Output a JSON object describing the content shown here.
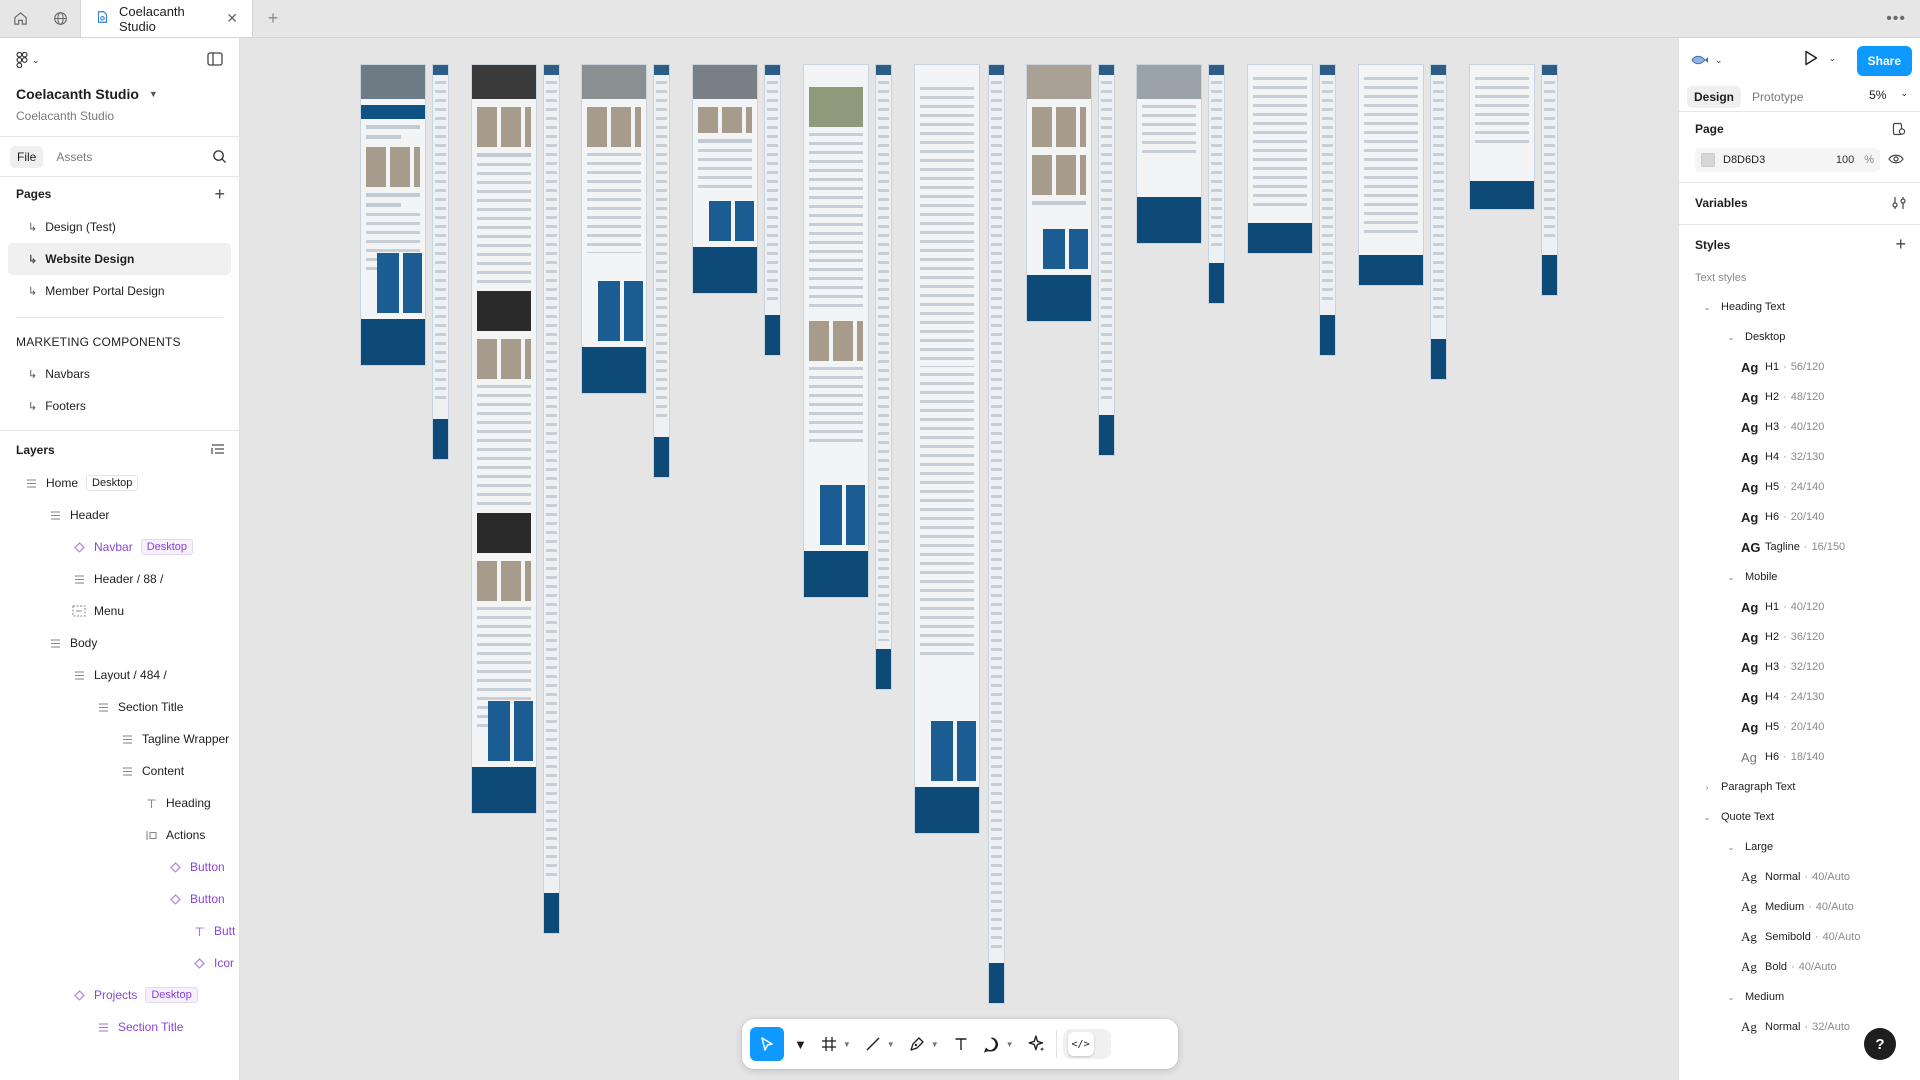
{
  "tabbar": {
    "tab_title": "Coelacanth Studio"
  },
  "left": {
    "project_name": "Coelacanth Studio",
    "team_name": "Coelacanth Studio",
    "tabs": {
      "file": "File",
      "assets": "Assets"
    },
    "pages_label": "Pages",
    "pages": [
      {
        "label": "Design (Test)"
      },
      {
        "label": "Website Design",
        "selected": true
      },
      {
        "label": "Member Portal Design"
      }
    ],
    "group_label": "MARKETING COMPONENTS",
    "group_pages": [
      {
        "label": "Navbars"
      },
      {
        "label": "Footers"
      }
    ],
    "layers_label": "Layers",
    "layers": [
      {
        "label": "Home",
        "badge": "Desktop",
        "icon": "frame-icon",
        "component": false
      },
      {
        "label": "Header",
        "badge": "",
        "icon": "frame-icon",
        "component": false
      },
      {
        "label": "Navbar",
        "badge": "Desktop",
        "icon": "instance-icon",
        "component": true
      },
      {
        "label": "Header / 88 /",
        "badge": "",
        "icon": "frame-icon",
        "component": false
      },
      {
        "label": "Menu",
        "badge": "",
        "icon": "menu-frame-icon",
        "component": false
      },
      {
        "label": "Body",
        "badge": "",
        "icon": "frame-icon",
        "component": false
      },
      {
        "label": "Layout / 484 /",
        "badge": "",
        "icon": "frame-icon",
        "component": false
      },
      {
        "label": "Section Title",
        "badge": "",
        "icon": "frame-icon",
        "component": false
      },
      {
        "label": "Tagline Wrapper",
        "badge": "",
        "icon": "frame-icon",
        "component": false
      },
      {
        "label": "Content",
        "badge": "",
        "icon": "frame-icon",
        "component": false
      },
      {
        "label": "Heading",
        "badge": "",
        "icon": "text-icon",
        "component": false
      },
      {
        "label": "Actions",
        "badge": "",
        "icon": "auto-layout-icon",
        "component": false
      },
      {
        "label": "Button",
        "badge": "",
        "icon": "instance-icon",
        "component": true
      },
      {
        "label": "Button",
        "badge": "",
        "icon": "instance-icon",
        "component": true
      },
      {
        "label": "Butt",
        "badge": "",
        "icon": "text-icon",
        "component": true
      },
      {
        "label": "Icor",
        "badge": "",
        "icon": "instance-icon",
        "component": true
      },
      {
        "label": "Projects",
        "badge": "Desktop",
        "icon": "instance-icon",
        "component": true
      },
      {
        "label": "Section Title",
        "badge": "",
        "icon": "frame-icon",
        "component": true
      }
    ]
  },
  "right": {
    "share_label": "Share",
    "tabs": {
      "design": "Design",
      "prototype": "Prototype"
    },
    "zoom": "5%",
    "page_label": "Page",
    "page_fill": {
      "hex": "D8D6D3",
      "opacity": "100",
      "unit": "%",
      "color": "#D8D6D3"
    },
    "variables_label": "Variables",
    "styles_label": "Styles",
    "text_styles_label": "Text styles",
    "styles": [
      {
        "kind": "group",
        "label": "Heading Text",
        "open": true
      },
      {
        "kind": "sub",
        "label": "Desktop",
        "open": true
      },
      {
        "kind": "style",
        "ag": "Ag",
        "name": "H1",
        "meta": "56/120",
        "weight": "bold"
      },
      {
        "kind": "style",
        "ag": "Ag",
        "name": "H2",
        "meta": "48/120",
        "weight": "bold"
      },
      {
        "kind": "style",
        "ag": "Ag",
        "name": "H3",
        "meta": "40/120",
        "weight": "bold"
      },
      {
        "kind": "style",
        "ag": "Ag",
        "name": "H4",
        "meta": "32/130",
        "weight": "bold"
      },
      {
        "kind": "style",
        "ag": "Ag",
        "name": "H5",
        "meta": "24/140",
        "weight": "bold"
      },
      {
        "kind": "style",
        "ag": "Ag",
        "name": "H6",
        "meta": "20/140",
        "weight": "bold"
      },
      {
        "kind": "style",
        "ag": "AG",
        "name": "Tagline",
        "meta": "16/150",
        "weight": "bold"
      },
      {
        "kind": "sub",
        "label": "Mobile",
        "open": true
      },
      {
        "kind": "style",
        "ag": "Ag",
        "name": "H1",
        "meta": "40/120",
        "weight": "bold"
      },
      {
        "kind": "style",
        "ag": "Ag",
        "name": "H2",
        "meta": "36/120",
        "weight": "bold"
      },
      {
        "kind": "style",
        "ag": "Ag",
        "name": "H3",
        "meta": "32/120",
        "weight": "bold"
      },
      {
        "kind": "style",
        "ag": "Ag",
        "name": "H4",
        "meta": "24/130",
        "weight": "bold"
      },
      {
        "kind": "style",
        "ag": "Ag",
        "name": "H5",
        "meta": "20/140",
        "weight": "bold"
      },
      {
        "kind": "style",
        "ag": "Ag",
        "name": "H6",
        "meta": "18/140",
        "weight": "light"
      },
      {
        "kind": "group",
        "label": "Paragraph Text",
        "open": false
      },
      {
        "kind": "group",
        "label": "Quote Text",
        "open": true
      },
      {
        "kind": "sub",
        "label": "Large",
        "open": true
      },
      {
        "kind": "style",
        "ag": "Ag",
        "name": "Normal",
        "meta": "40/Auto",
        "weight": "serif"
      },
      {
        "kind": "style",
        "ag": "Ag",
        "name": "Medium",
        "meta": "40/Auto",
        "weight": "serif"
      },
      {
        "kind": "style",
        "ag": "Ag",
        "name": "Semibold",
        "meta": "40/Auto",
        "weight": "serif"
      },
      {
        "kind": "style",
        "ag": "Ag",
        "name": "Bold",
        "meta": "40/Auto",
        "weight": "serif"
      },
      {
        "kind": "sub",
        "label": "Medium",
        "open": true
      },
      {
        "kind": "style",
        "ag": "Ag",
        "name": "Normal",
        "meta": "32/Auto",
        "weight": "serif"
      }
    ],
    "help_label": "?"
  }
}
